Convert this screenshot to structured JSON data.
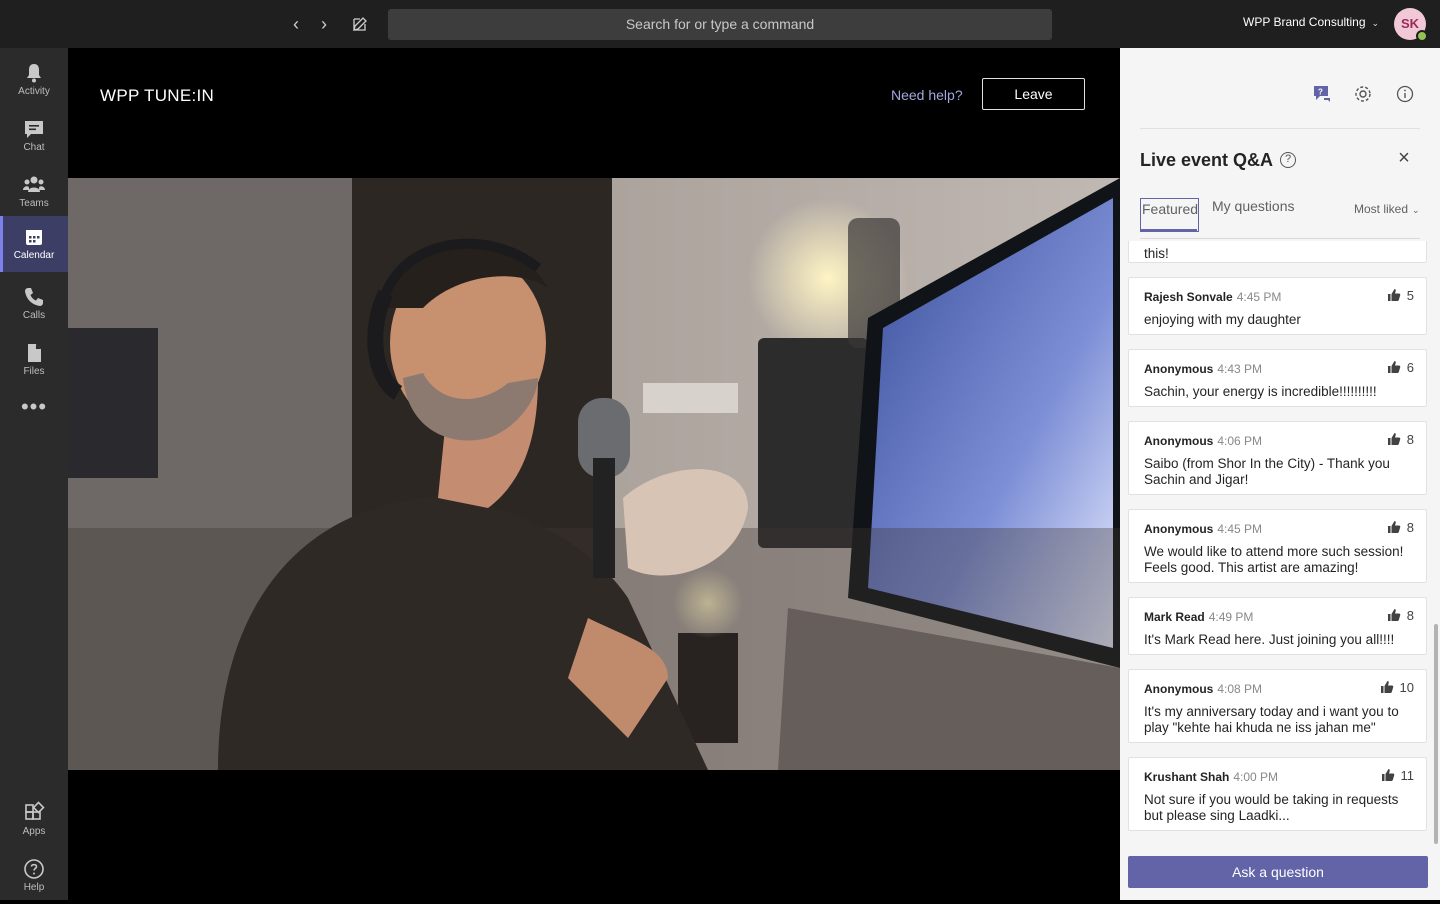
{
  "topbar": {
    "search_placeholder": "Search for or type a command",
    "org_name": "WPP Brand Consulting",
    "avatar_initials": "SK"
  },
  "rail": {
    "items": [
      {
        "label": "Activity",
        "icon": "bell-icon"
      },
      {
        "label": "Chat",
        "icon": "chat-icon"
      },
      {
        "label": "Teams",
        "icon": "teams-icon"
      },
      {
        "label": "Calendar",
        "icon": "calendar-icon"
      },
      {
        "label": "Calls",
        "icon": "phone-icon"
      },
      {
        "label": "Files",
        "icon": "file-icon"
      }
    ],
    "apps_label": "Apps",
    "help_label": "Help"
  },
  "stage": {
    "event_title": "WPP TUNE:IN",
    "help_link": "Need help?",
    "leave_label": "Leave"
  },
  "qa": {
    "title": "Live event Q&A",
    "tabs": [
      "Featured",
      "My questions"
    ],
    "sort_label": "Most liked",
    "partial_text": "this!",
    "questions": [
      {
        "author": "Rajesh Sonvale",
        "time": "4:45 PM",
        "likes": "5",
        "text": "enjoying with my daughter"
      },
      {
        "author": "Anonymous",
        "time": "4:43 PM",
        "likes": "6",
        "text": "Sachin, your energy is incredible!!!!!!!!!!"
      },
      {
        "author": "Anonymous",
        "time": "4:06 PM",
        "likes": "8",
        "text": "Saibo (from Shor In the City) - Thank you Sachin and Jigar!"
      },
      {
        "author": "Anonymous",
        "time": "4:45 PM",
        "likes": "8",
        "text": "We would like to attend more such session! Feels good. This artist are amazing!"
      },
      {
        "author": "Mark Read",
        "time": "4:49 PM",
        "likes": "8",
        "text": "It's Mark Read here. Just joining you all!!!!"
      },
      {
        "author": "Anonymous",
        "time": "4:08 PM",
        "likes": "10",
        "text": "It's my anniversary today and i want you to play \"kehte hai khuda ne iss jahan me\""
      },
      {
        "author": "Krushant Shah",
        "time": "4:00 PM",
        "likes": "11",
        "text": "Not sure if you would be taking in requests but please sing Laadki..."
      }
    ],
    "ask_label": "Ask a question"
  }
}
